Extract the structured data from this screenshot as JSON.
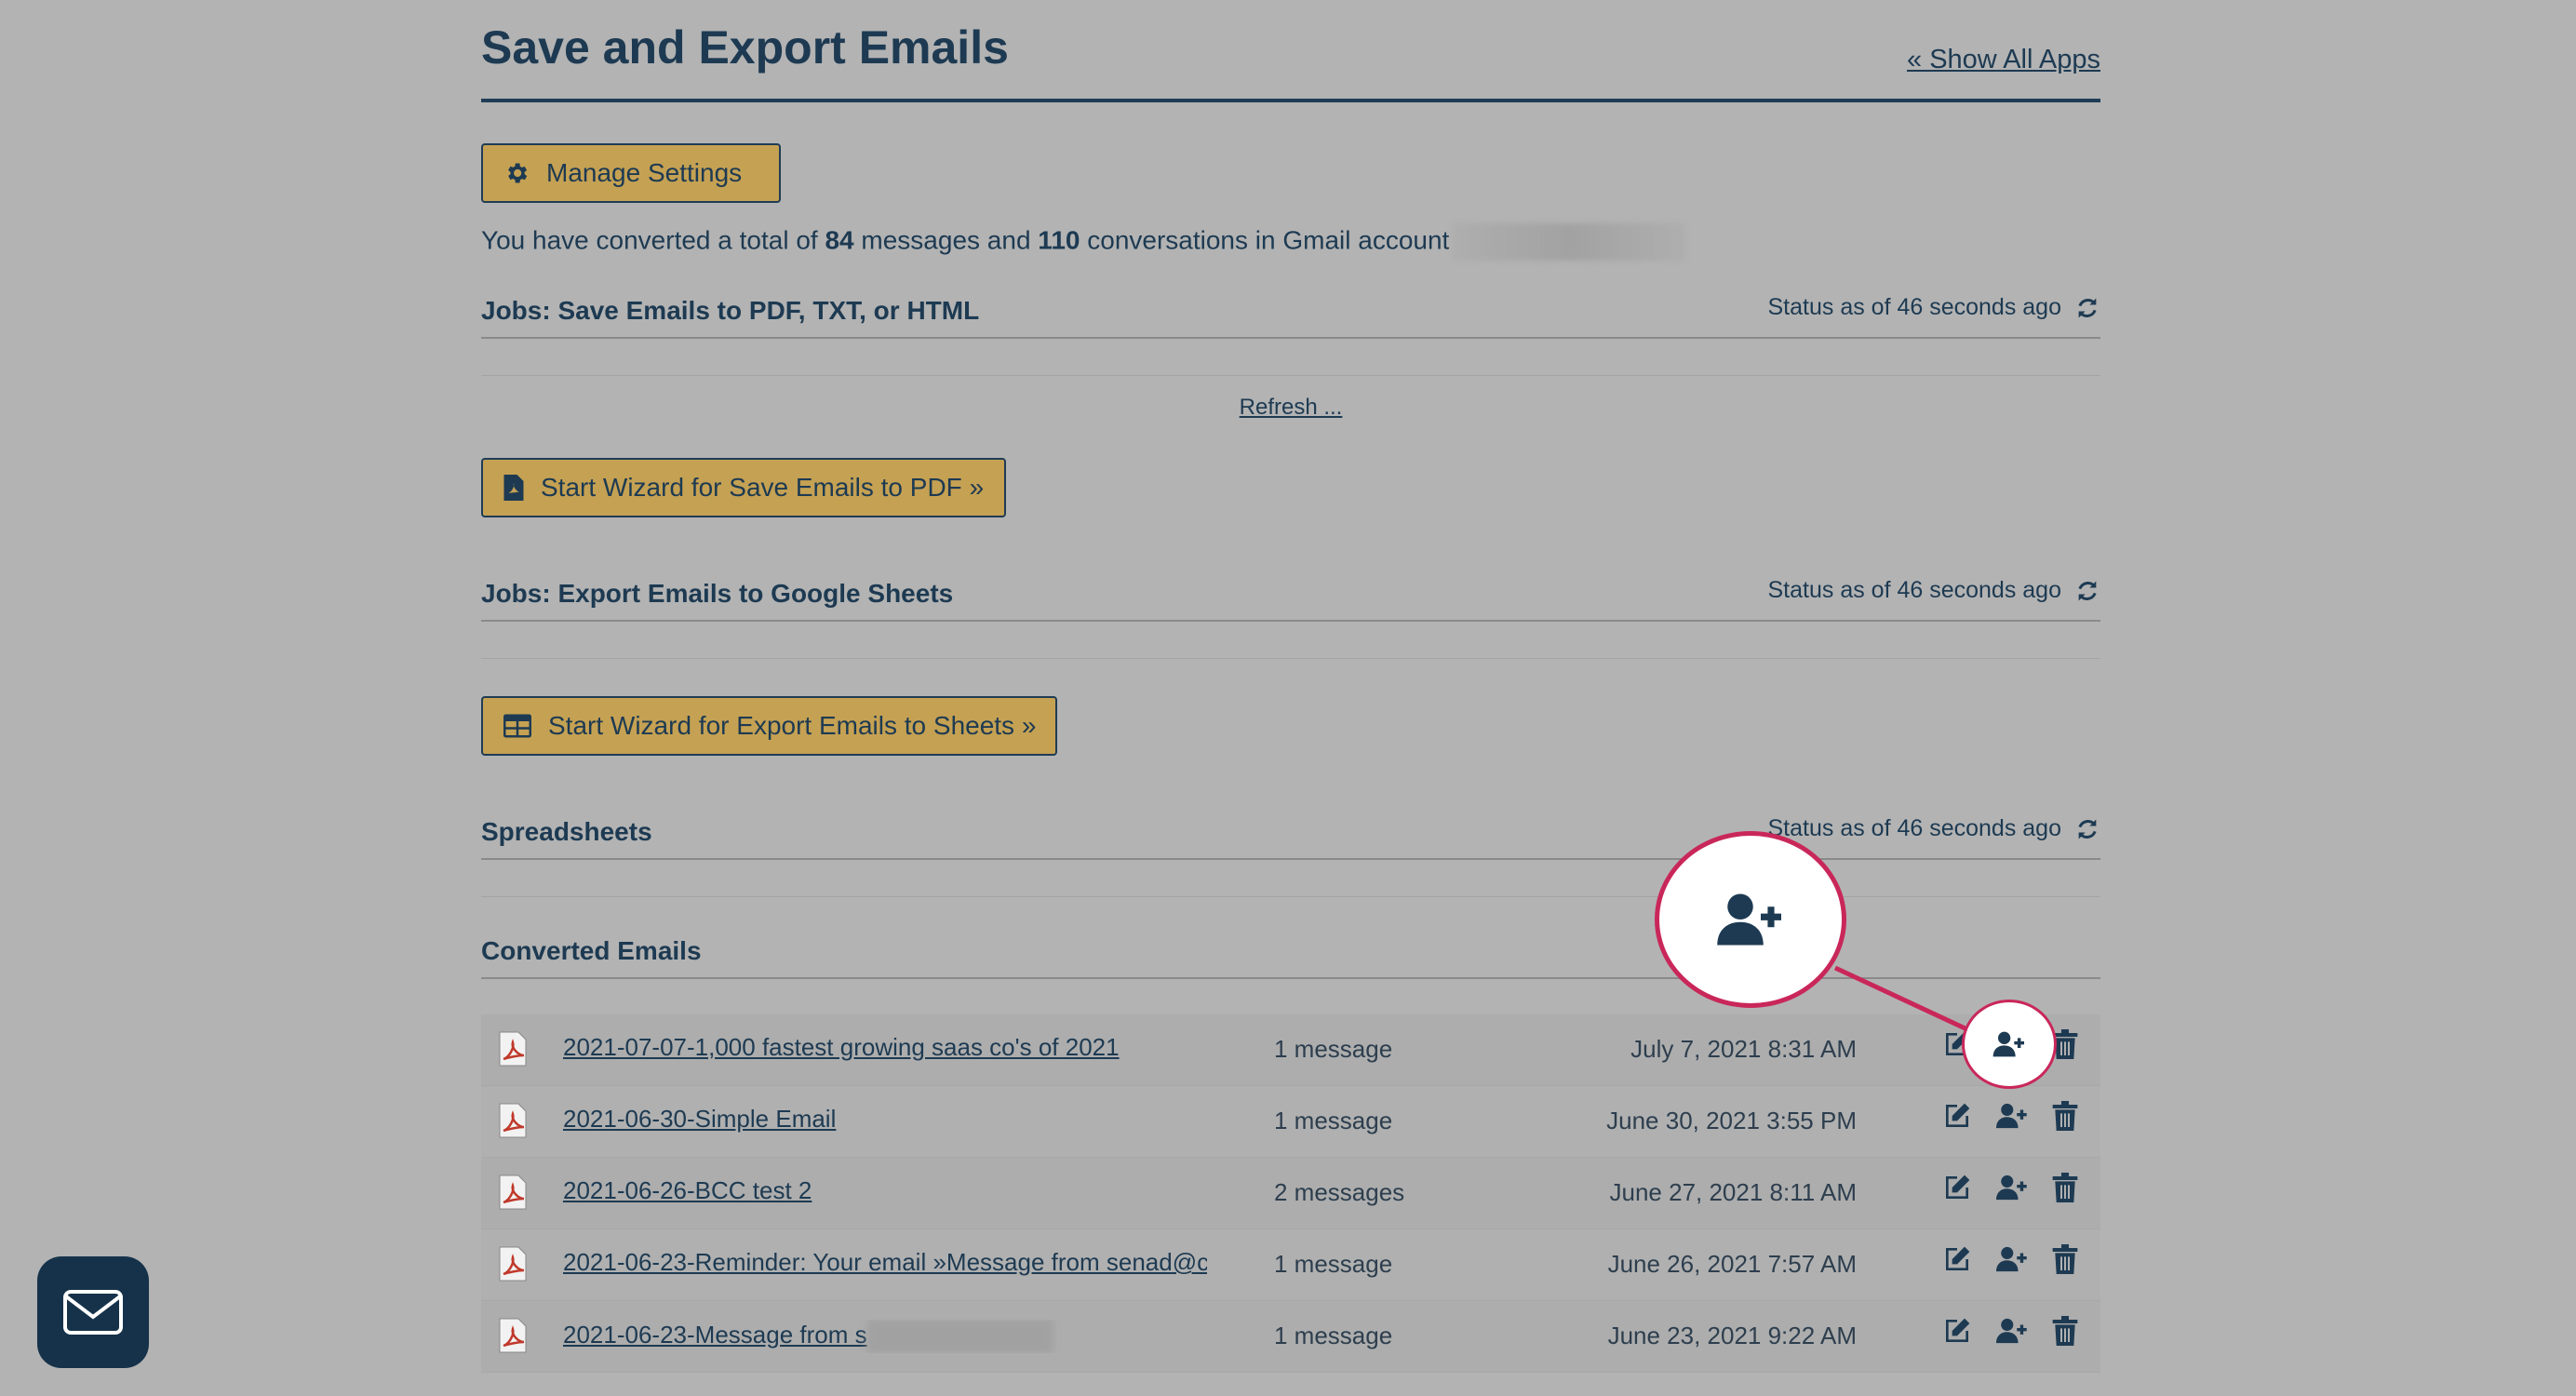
{
  "header": {
    "title": "Save and Export Emails",
    "show_all_apps": "« Show All Apps"
  },
  "manage_settings_label": "Manage Settings",
  "summary": {
    "prefix": "You have converted a total of",
    "messages_count": "84",
    "middle": "messages and",
    "conversations_count": "110",
    "suffix": "conversations in Gmail account"
  },
  "sections": {
    "pdf_jobs": {
      "title": "Jobs: Save Emails to PDF, TXT, or HTML",
      "status": "Status as of 46 seconds ago"
    },
    "sheets_jobs": {
      "title": "Jobs: Export Emails to Google Sheets",
      "status": "Status as of 46 seconds ago"
    },
    "spreadsheets": {
      "title": "Spreadsheets",
      "status": "Status as of 46 seconds ago"
    },
    "converted": {
      "title": "Converted Emails"
    }
  },
  "refresh_label": "Refresh ...",
  "wizard_pdf_label": "Start Wizard for Save Emails to PDF  »",
  "wizard_sheets_label": "Start Wizard for Export Emails to Sheets  »",
  "converted_emails": [
    {
      "name": "2021-07-07-1,000 fastest growing saas co's of 2021",
      "count": "1 message",
      "date": "July 7, 2021 8:31 AM"
    },
    {
      "name": "2021-06-30-Simple Email",
      "count": "1 message",
      "date": "June 30, 2021 3:55 PM"
    },
    {
      "name": "2021-06-26-BCC test 2",
      "count": "2 messages",
      "date": "June 27, 2021 8:11 AM"
    },
    {
      "name": "2021-06-23-Reminder: Your email »Message from senad@c",
      "count": "1 message",
      "date": "June 26, 2021 7:57 AM"
    },
    {
      "name": "2021-06-23-Message from s",
      "count": "1 message",
      "date": "June 23, 2021 9:22 AM"
    }
  ],
  "colors": {
    "accent_button": "#c5a153",
    "text_primary": "#1d3a52",
    "highlight": "#c9275a",
    "background": "#b3b3b3"
  },
  "icons": {
    "settings": "gear-icon",
    "refresh": "refresh-icon",
    "pdf": "pdf-file-icon",
    "table": "table-icon",
    "edit": "edit-icon",
    "share": "add-user-icon",
    "delete": "trash-icon",
    "mail": "mail-icon"
  }
}
